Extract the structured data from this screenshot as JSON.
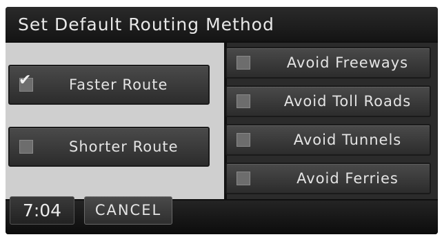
{
  "header": {
    "title": "Set Default Routing Method"
  },
  "route_options": [
    {
      "label": "Faster Route",
      "checked": true
    },
    {
      "label": "Shorter Route",
      "checked": false
    }
  ],
  "avoid_options": [
    {
      "label": "Avoid Freeways",
      "checked": false
    },
    {
      "label": "Avoid Toll Roads",
      "checked": false
    },
    {
      "label": "Avoid Tunnels",
      "checked": false
    },
    {
      "label": "Avoid Ferries",
      "checked": false
    }
  ],
  "footer": {
    "time": "7:04",
    "cancel_label": "CANCEL"
  },
  "icons": {
    "checked": "checkmark-icon",
    "unchecked": "empty-checkbox-icon"
  },
  "colors": {
    "button_face": "#3a3a3a",
    "left_panel": "#cfcfcf",
    "background": "#0f0f0f",
    "text": "#e4e4e4"
  }
}
